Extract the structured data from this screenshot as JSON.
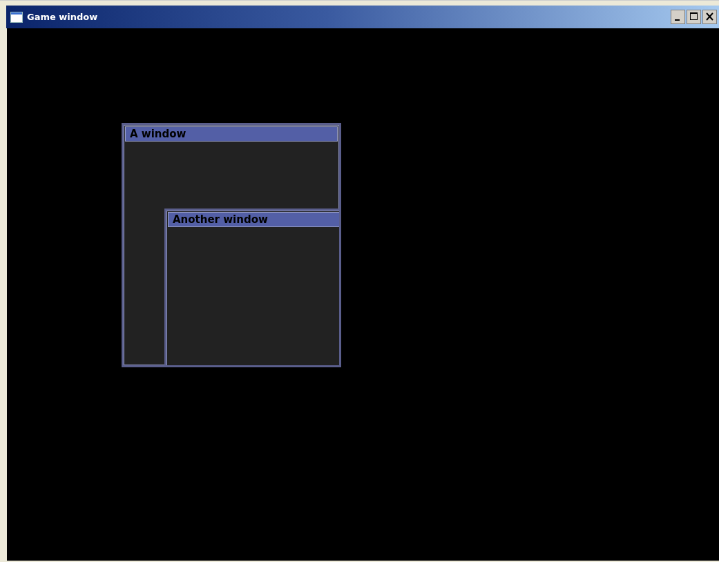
{
  "window": {
    "title": "Game window"
  },
  "game_windows": [
    {
      "title": "A window",
      "children": [
        {
          "title": "Another window"
        }
      ]
    }
  ]
}
